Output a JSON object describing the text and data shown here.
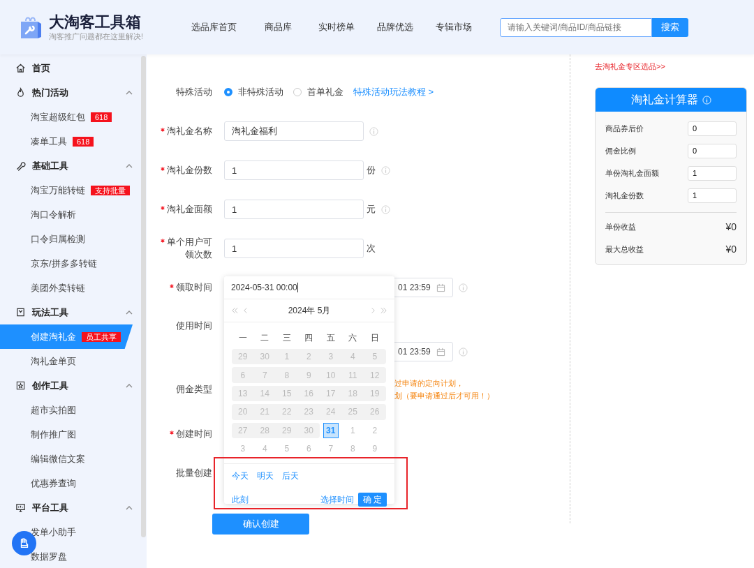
{
  "header": {
    "title": "大淘客工具箱",
    "slogan": "淘客推广问题都在这里解决!",
    "nav": [
      "选品库首页",
      "商品库",
      "实时榜单",
      "品牌优选",
      "专辑市场"
    ],
    "search": {
      "placeholder": "请输入关键词/商品ID/商品链接",
      "button": "搜索"
    }
  },
  "sidebar": {
    "items": [
      {
        "kind": "link",
        "label": "首页"
      },
      {
        "kind": "section",
        "label": "热门活动",
        "expanded": true,
        "children": [
          {
            "label": "淘宝超级红包",
            "badge": "618",
            "selected": false
          },
          {
            "label": "凑单工具",
            "badge": "618",
            "selected": false
          }
        ]
      },
      {
        "kind": "section",
        "label": "基础工具",
        "expanded": true,
        "children": [
          {
            "label": "淘宝万能转链",
            "badge": "支持批量",
            "selected": false
          },
          {
            "label": "淘口令解析",
            "selected": false
          },
          {
            "label": "口令归属检测",
            "selected": false
          },
          {
            "label": "京东/拼多多转链",
            "selected": false
          },
          {
            "label": "美团外卖转链",
            "selected": false
          }
        ]
      },
      {
        "kind": "section",
        "label": "玩法工具",
        "expanded": true,
        "children": [
          {
            "label": "创建淘礼金",
            "badge": "员工共享",
            "selected": true
          },
          {
            "label": "淘礼金单页",
            "selected": false
          }
        ]
      },
      {
        "kind": "section",
        "label": "创作工具",
        "expanded": true,
        "children": [
          {
            "label": "超市实拍图",
            "selected": false
          },
          {
            "label": "制作推广图",
            "selected": false
          },
          {
            "label": "编辑微信文案",
            "selected": false
          },
          {
            "label": "优惠券查询",
            "selected": false
          }
        ]
      },
      {
        "kind": "section",
        "label": "平台工具",
        "expanded": true,
        "children": [
          {
            "label": "发单小助手",
            "selected": false
          },
          {
            "label": "数据罗盘",
            "selected": false
          }
        ]
      }
    ]
  },
  "form": {
    "rows": [
      {
        "kind": "radio",
        "label": "特殊活动",
        "required": false,
        "options": [
          {
            "label": "非特殊活动",
            "selected": true
          },
          {
            "label": "首单礼金",
            "selected": false
          }
        ],
        "link": "特殊活动玩法教程 >"
      },
      {
        "kind": "input",
        "label": "淘礼金名称",
        "required": true,
        "value": "淘礼金福利",
        "info": true
      },
      {
        "kind": "input",
        "label": "淘礼金份数",
        "required": true,
        "value": "1",
        "unit": "份",
        "info": true
      },
      {
        "kind": "input",
        "label": "淘礼金面额",
        "required": true,
        "value": "1",
        "unit": "元",
        "info": true
      },
      {
        "kind": "input",
        "label": "单个用户可领次数",
        "required": true,
        "value": "1",
        "unit": "次",
        "info": false
      },
      {
        "kind": "range",
        "label": "领取时间",
        "required": true,
        "value_end": "01 23:59",
        "info": true
      },
      {
        "kind": "range",
        "label": "使用时间",
        "required": false,
        "value_end": "01 23:59",
        "info": true
      },
      {
        "kind": "note",
        "label": "佣金类型",
        "required": false,
        "lines": [
          "过申请的定向计划，",
          "划（要申请通过后才可用！）"
        ]
      },
      {
        "kind": "blank",
        "label": "创建时间",
        "required": true
      },
      {
        "kind": "blank",
        "label": "批量创建",
        "required": false
      }
    ],
    "submit": "确认创建"
  },
  "date_picker": {
    "input_value": "2024-05-31 00:00",
    "month_label": "2024年 5月",
    "weekdays": [
      "一",
      "二",
      "三",
      "四",
      "五",
      "六",
      "日"
    ],
    "weeks": [
      [
        {
          "label": "29",
          "kind": "disabled",
          "selected": false
        },
        {
          "label": "30",
          "kind": "disabled",
          "selected": false
        },
        {
          "label": "1",
          "kind": "disabled",
          "selected": false
        },
        {
          "label": "2",
          "kind": "disabled",
          "selected": false
        },
        {
          "label": "3",
          "kind": "disabled",
          "selected": false
        },
        {
          "label": "4",
          "kind": "disabled",
          "selected": false
        },
        {
          "label": "5",
          "kind": "disabled",
          "selected": false
        }
      ],
      [
        {
          "label": "6",
          "kind": "disabled",
          "selected": false
        },
        {
          "label": "7",
          "kind": "disabled",
          "selected": false
        },
        {
          "label": "8",
          "kind": "disabled",
          "selected": false
        },
        {
          "label": "9",
          "kind": "disabled",
          "selected": false
        },
        {
          "label": "10",
          "kind": "disabled",
          "selected": false
        },
        {
          "label": "11",
          "kind": "disabled",
          "selected": false
        },
        {
          "label": "12",
          "kind": "disabled",
          "selected": false
        }
      ],
      [
        {
          "label": "13",
          "kind": "disabled",
          "selected": false
        },
        {
          "label": "14",
          "kind": "disabled",
          "selected": false
        },
        {
          "label": "15",
          "kind": "disabled",
          "selected": false
        },
        {
          "label": "16",
          "kind": "disabled",
          "selected": false
        },
        {
          "label": "17",
          "kind": "disabled",
          "selected": false
        },
        {
          "label": "18",
          "kind": "disabled",
          "selected": false
        },
        {
          "label": "19",
          "kind": "disabled",
          "selected": false
        }
      ],
      [
        {
          "label": "20",
          "kind": "disabled",
          "selected": false
        },
        {
          "label": "21",
          "kind": "disabled",
          "selected": false
        },
        {
          "label": "22",
          "kind": "disabled",
          "selected": false
        },
        {
          "label": "23",
          "kind": "disabled",
          "selected": false
        },
        {
          "label": "24",
          "kind": "disabled",
          "selected": false
        },
        {
          "label": "25",
          "kind": "disabled",
          "selected": false
        },
        {
          "label": "26",
          "kind": "disabled",
          "selected": false
        }
      ],
      [
        {
          "label": "27",
          "kind": "disabled",
          "selected": false
        },
        {
          "label": "28",
          "kind": "disabled",
          "selected": false
        },
        {
          "label": "29",
          "kind": "disabled",
          "selected": false
        },
        {
          "label": "30",
          "kind": "disabled",
          "selected": false
        },
        {
          "label": "31",
          "kind": "normal",
          "selected": true
        },
        {
          "label": "1",
          "kind": "next",
          "selected": false
        },
        {
          "label": "2",
          "kind": "next",
          "selected": false
        }
      ],
      [
        {
          "label": "3",
          "kind": "next",
          "selected": false
        },
        {
          "label": "4",
          "kind": "next",
          "selected": false
        },
        {
          "label": "5",
          "kind": "next",
          "selected": false
        },
        {
          "label": "6",
          "kind": "next",
          "selected": false
        },
        {
          "label": "7",
          "kind": "next",
          "selected": false
        },
        {
          "label": "8",
          "kind": "next",
          "selected": false
        },
        {
          "label": "9",
          "kind": "next",
          "selected": false
        }
      ]
    ],
    "shortcuts": [
      "今天",
      "明天",
      "后天"
    ],
    "now": "此刻",
    "pick_time": "选择时间",
    "confirm": "确 定"
  },
  "side_panel": {
    "link": "去淘礼金专区选品>>",
    "calculator": {
      "title": "淘礼金计算器",
      "fields": [
        {
          "label": "商品券后价",
          "value": "0"
        },
        {
          "label": "佣金比例",
          "value": "0"
        },
        {
          "label": "单份淘礼金面额",
          "value": "1"
        },
        {
          "label": "淘礼金份数",
          "value": "1"
        }
      ],
      "results": [
        {
          "label": "单份收益",
          "value": "¥0"
        },
        {
          "label": "最大总收益",
          "value": "¥0"
        }
      ]
    }
  }
}
